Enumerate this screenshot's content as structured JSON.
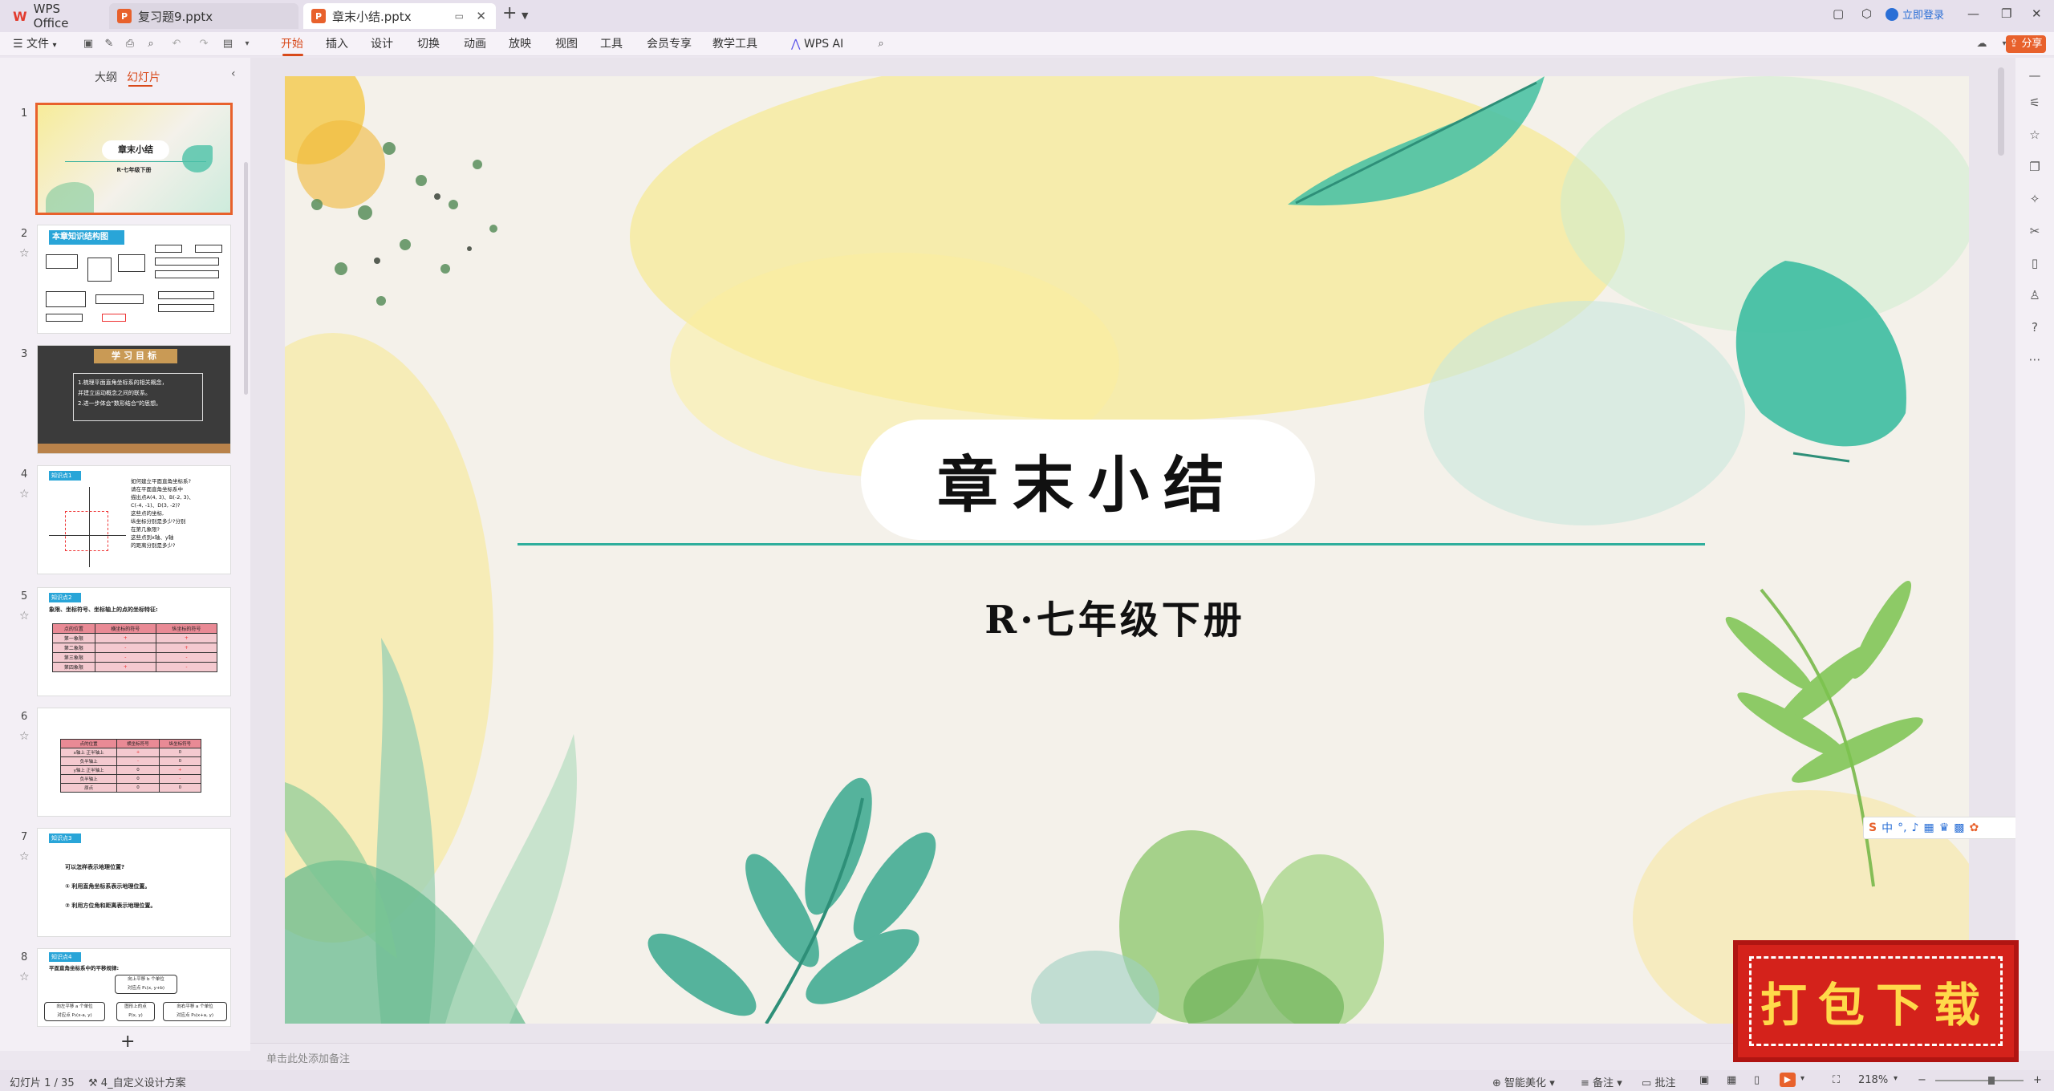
{
  "titlebar": {
    "tabs": [
      {
        "label": "WPS Office",
        "icon": "wps-logo-icon"
      },
      {
        "label": "复习题9.pptx",
        "icon": "ppt-file-icon"
      },
      {
        "label": "章末小结.pptx",
        "icon": "ppt-file-icon",
        "active": true
      }
    ],
    "new_tab": "+",
    "login": "立即登录"
  },
  "ribbon": {
    "menu_label": "文件",
    "tabs": [
      "开始",
      "插入",
      "设计",
      "切换",
      "动画",
      "放映",
      "视图",
      "工具",
      "会员专享",
      "教学工具",
      "WPS AI"
    ],
    "active_tab": "开始",
    "share": "分享"
  },
  "left_panel": {
    "tabs": [
      "大纲",
      "幻灯片"
    ],
    "active_tab": "幻灯片",
    "add_button": "+",
    "thumbnails": [
      {
        "num": "1",
        "title": "章末小结",
        "sub": "R·七年级下册"
      },
      {
        "num": "2",
        "title": "本章知识结构图"
      },
      {
        "num": "3",
        "title": "学习目标",
        "lines": [
          "1.梳理平面直角坐标系的相关概念，",
          "  并建立运动概念之间的联系。",
          "2.进一步体会\"数形结合\"的思想。"
        ]
      },
      {
        "num": "4",
        "title": "知识点1",
        "lines": [
          "如何建立平面直角坐标系?",
          "请在平面直角坐标系中",
          "描出点A(4, 3)、B(-2, 3)、",
          "C(-4, -1)、D(3, -2)?",
          "这些点的坐标,",
          "纵坐标分别是多少?分别",
          "在第几象限?",
          "这些点到x轴、y轴",
          "的距离分别是多少?"
        ]
      },
      {
        "num": "5",
        "title": "知识点2",
        "lines": [
          "象限、坐标符号、坐标轴上的点的坐标特征:"
        ],
        "table": [
          [
            "点的位置",
            "横坐标的符号",
            "纵坐标的符号"
          ],
          [
            "第一象限",
            "+",
            "+"
          ],
          [
            "第二象限",
            "-",
            "+"
          ],
          [
            "第三象限",
            "-",
            "-"
          ],
          [
            "第四象限",
            "+",
            "-"
          ]
        ]
      },
      {
        "num": "6",
        "table": [
          [
            "点的位置",
            "横坐标符号",
            "纵坐标符号"
          ],
          [
            "x轴上 正半轴上",
            "+",
            "0"
          ],
          [
            "负半轴上",
            "-",
            "0"
          ],
          [
            "y轴上 正半轴上",
            "0",
            "+"
          ],
          [
            "负半轴上",
            "0",
            "-"
          ],
          [
            "原点",
            "0",
            "0"
          ]
        ]
      },
      {
        "num": "7",
        "title": "知识点3",
        "lines": [
          "可以怎样表示地理位置?",
          "① 利用直角坐标系表示地理位置。",
          "② 利用方位角和距离表示地理位置。"
        ]
      },
      {
        "num": "8",
        "title": "知识点4",
        "lines": [
          "平面直角坐标系中的平移规律:",
          "向上平移 b 个单位",
          "对应点 P₁(x, y+b)",
          "向左平移 a 个单位",
          "对应点 P₂(x-a, y)",
          "图形上的点",
          "P(x, y)",
          "向右平移 a 个单位",
          "对应点 P₃(x+a, y)"
        ]
      }
    ]
  },
  "slide": {
    "title": "章末小结",
    "subtitle": "R·七年级下册"
  },
  "notes_placeholder": "单击此处添加备注",
  "statusbar": {
    "slide_info": "幻灯片 1 / 35",
    "theme": "4_自定义设计方案",
    "smart": "智能美化",
    "notes": "备注",
    "comment": "批注",
    "zoom": "218%"
  },
  "ime": {
    "lang": "中"
  },
  "stamp": {
    "text": "打包下载"
  }
}
